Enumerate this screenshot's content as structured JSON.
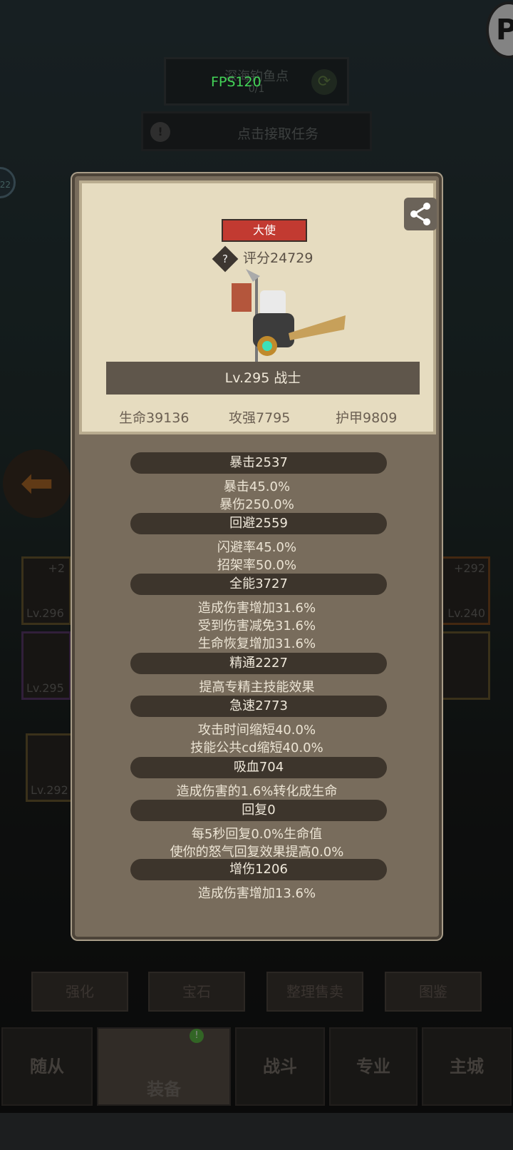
{
  "hud": {
    "fps": "FPS120",
    "location": "深海钓鱼点",
    "progress": "0/1",
    "task_label": "点击接取任务",
    "badge_num": "22"
  },
  "character": {
    "title_badge": "大使",
    "score_label": "评分24729",
    "level_class": "Lv.295 战士",
    "hp": "生命39136",
    "atk": "攻强7795",
    "armor": "护甲9809"
  },
  "stats": [
    {
      "label": "暴击2537",
      "details": [
        "暴击45.0%",
        "暴伤250.0%"
      ]
    },
    {
      "label": "回避2559",
      "details": [
        "闪避率45.0%",
        "招架率50.0%"
      ]
    },
    {
      "label": "全能3727",
      "details": [
        "造成伤害增加31.6%",
        "受到伤害减免31.6%",
        "生命恢复增加31.6%"
      ]
    },
    {
      "label": "精通2227",
      "details": [
        "提高专精主技能效果"
      ]
    },
    {
      "label": "急速2773",
      "details": [
        "攻击时间缩短40.0%",
        "技能公共cd缩短40.0%"
      ]
    },
    {
      "label": "吸血704",
      "details": [
        "造成伤害的1.6%转化成生命"
      ]
    },
    {
      "label": "回复0",
      "details": [
        "每5秒回复0.0%生命值",
        "使你的怒气回复效果提高0.0%"
      ]
    },
    {
      "label": "增伤1206",
      "details": [
        "造成伤害增加13.6%"
      ]
    }
  ],
  "equip_slots": {
    "left1_lv": "Lv.296",
    "left1_plus": "+2",
    "left2_lv": "Lv.295",
    "left3_lv": "Lv.292",
    "right1_lv": "Lv.240",
    "right1_plus": "+292"
  },
  "bottom_buttons": [
    "强化",
    "宝石",
    "整理售卖",
    "图鉴"
  ],
  "nav": {
    "followers": "随从",
    "equipment": "装备",
    "battle": "战斗",
    "profession": "专业",
    "main_city": "主城"
  },
  "colors": {
    "panel": "#786c5c",
    "card": "#e6dcc0",
    "badge": "#c23a31",
    "fps": "#43d357"
  }
}
